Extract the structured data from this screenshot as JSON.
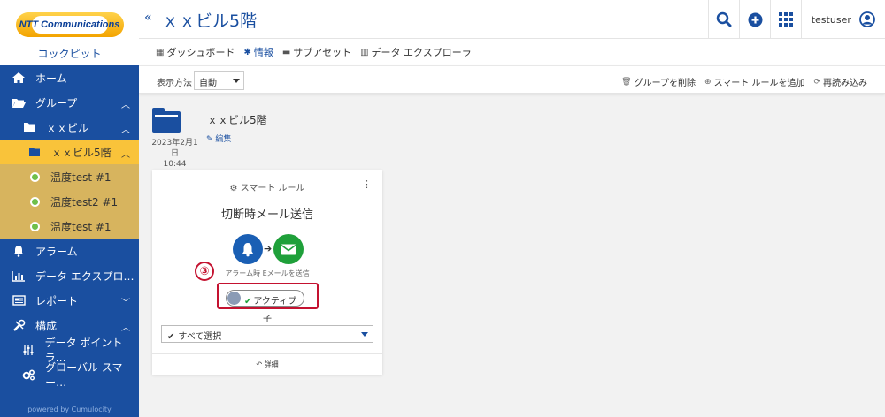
{
  "sidebar": {
    "logo_text": "NTT Communications",
    "app_name": "コックピット",
    "items": [
      {
        "label": "ホーム",
        "icon": "home-icon"
      },
      {
        "label": "グループ",
        "icon": "folder-open-icon"
      },
      {
        "label": "ｘｘビル",
        "icon": "folder-icon"
      },
      {
        "label": "ｘｘビル5階",
        "icon": "folder-icon"
      },
      {
        "label": "温度test #1",
        "icon": "device-icon"
      },
      {
        "label": "温度test2 #1",
        "icon": "device-icon"
      },
      {
        "label": "温度test #1",
        "icon": "device-icon"
      },
      {
        "label": "アラーム",
        "icon": "bell-icon"
      },
      {
        "label": "データ エクスプロ…",
        "icon": "bar-chart-icon"
      },
      {
        "label": "レポート",
        "icon": "report-icon"
      },
      {
        "label": "構成",
        "icon": "tools-icon"
      },
      {
        "label": "データ ポイント ラ…",
        "icon": "sliders-icon"
      },
      {
        "label": "グローバル スマー…",
        "icon": "gears-icon"
      }
    ],
    "powered_by": "powered by Cumulocity"
  },
  "header": {
    "collapse_glyph": "«",
    "title": "ｘｘビル5階",
    "username": "testuser"
  },
  "tabs": [
    {
      "label": "ダッシュボード",
      "icon": "grid-icon"
    },
    {
      "label": "情報",
      "icon": "asterisk-icon"
    },
    {
      "label": "サブアセット",
      "icon": "folder-icon"
    },
    {
      "label": "データ エクスプローラ",
      "icon": "bar-chart-icon"
    }
  ],
  "filter": {
    "label": "表示方法",
    "value": "自動",
    "actions": [
      {
        "label": "グループを削除",
        "icon": "trash-icon"
      },
      {
        "label": "スマート ルールを追加",
        "icon": "plus-circle-icon"
      },
      {
        "label": "再読み込み",
        "icon": "refresh-icon"
      }
    ]
  },
  "group": {
    "title": "ｘｘビル5階",
    "date": "2023年2月1日",
    "time": "10:44",
    "edit_label": "編集"
  },
  "card": {
    "kicker": "スマート ルール",
    "title": "切断時メール送信",
    "caption": "アラーム時 Eメールを送信",
    "toggle_label": "アクティブ",
    "annotation": "③",
    "child_label": "子",
    "select_all_label": "すべて選択",
    "detail_label": "詳細"
  },
  "colors": {
    "brand_blue": "#1a4fa0",
    "active_yellow": "#f9c33a",
    "highlight_red": "#c41230",
    "mail_green": "#1fa03a"
  }
}
